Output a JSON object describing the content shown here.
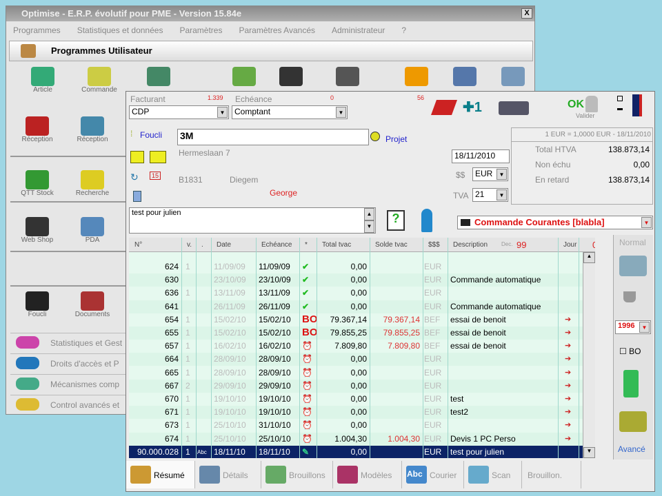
{
  "window": {
    "title": "Optimise  -  E.R.P. évolutif pour PME  -  Version 15.84e",
    "close": "X"
  },
  "menu": [
    "Programmes",
    "Statistiques et données",
    "Paramètres",
    "Paramètres Avancés",
    "Administrateur",
    "?"
  ],
  "programs_title": "Programmes Utilisateur",
  "launcher": [
    {
      "label": "Article",
      "color": "#3a7"
    },
    {
      "label": "Commande",
      "color": "#cc4"
    },
    {
      "label": "",
      "color": "#486"
    },
    {
      "label": "",
      "color": "#6a4"
    },
    {
      "label": "",
      "color": "#333"
    },
    {
      "label": "",
      "color": "#555"
    },
    {
      "label": "",
      "color": "#e90"
    },
    {
      "label": "",
      "color": "#57a"
    },
    {
      "label": "",
      "color": "#79b"
    }
  ],
  "side_icons": [
    {
      "label": "Réception",
      "color": "#b22"
    },
    {
      "label": "Réception",
      "color": "#48a"
    },
    {
      "label": "QTT Stock",
      "color": "#393"
    },
    {
      "label": "Recherche",
      "color": "#dc2"
    },
    {
      "label": "Web Shop",
      "color": "#333"
    },
    {
      "label": "PDA",
      "color": "#58b"
    },
    {
      "label": "Foucli",
      "color": "#222"
    },
    {
      "label": "Documents",
      "color": "#a33"
    }
  ],
  "side_items": [
    "Statistiques et Gest",
    "Droits d'accès et P",
    "Mécanismes comp",
    "Control avancés et"
  ],
  "doc": {
    "facturant_label": "Facturant",
    "facturant_count": "1.339",
    "echeance_label": "Echéance",
    "echeance_count": "0",
    "count3": "56",
    "facturant": "CDP",
    "echeance": "Comptant",
    "ok": "OK",
    "valider": "Valider",
    "foucli_link": "Foucli",
    "client": "3M",
    "projet_link": "Projet",
    "address": "Hermeslaan 7",
    "postcode": "B1831",
    "city": "Diegem",
    "contact": "George",
    "date": "18/11/2010",
    "currency_label": "$$",
    "currency": "EUR",
    "tva_label": "TVA",
    "tva": "21",
    "rate": "1 EUR = 1,0000 EUR - 18/11/2010",
    "totals": [
      {
        "label": "Total HTVA",
        "value": "138.873,14"
      },
      {
        "label": "Non échu",
        "value": "0,00"
      },
      {
        "label": "En retard",
        "value": "138.873,14"
      }
    ],
    "note": "test pour julien",
    "doc_type": "Commande Courantes [blabla]"
  },
  "columns": [
    "N°",
    "v.",
    ".",
    "Date",
    "Echéance",
    "*",
    "Total tvac",
    "Solde tvac",
    "$$$",
    "Description",
    "Jour"
  ],
  "dec_label": "Dec.",
  "dec_value": "99",
  "count_zero": "0",
  "rows": [
    {
      "n": "624",
      "v": "1",
      "date": "11/09/09",
      "ech": "11/09/09",
      "st": "check",
      "total": "0,00",
      "solde": "",
      "cur": "EUR",
      "desc": "",
      "jour": ""
    },
    {
      "n": "630",
      "v": "",
      "date": "23/10/09",
      "ech": "23/10/09",
      "st": "check",
      "total": "0,00",
      "solde": "",
      "cur": "EUR",
      "desc": "Commande automatique",
      "jour": ""
    },
    {
      "n": "636",
      "v": "1",
      "date": "13/11/09",
      "ech": "13/11/09",
      "st": "check",
      "total": "0,00",
      "solde": "",
      "cur": "EUR",
      "desc": "",
      "jour": ""
    },
    {
      "n": "641",
      "v": "",
      "date": "26/11/09",
      "ech": "26/11/09",
      "st": "check",
      "total": "0,00",
      "solde": "",
      "cur": "EUR",
      "desc": "Commande automatique",
      "jour": ""
    },
    {
      "n": "654",
      "v": "1",
      "date": "15/02/10",
      "ech": "15/02/10",
      "st": "BO",
      "total": "79.367,14",
      "solde": "79.367,14",
      "cur": "BEF",
      "desc": "essai de benoit",
      "jour": "arrow"
    },
    {
      "n": "655",
      "v": "1",
      "date": "15/02/10",
      "ech": "15/02/10",
      "st": "BO",
      "total": "79.855,25",
      "solde": "79.855,25",
      "cur": "BEF",
      "desc": "essai de benoit",
      "jour": "arrow"
    },
    {
      "n": "657",
      "v": "1",
      "date": "16/02/10",
      "ech": "16/02/10",
      "st": "clock",
      "total": "7.809,80",
      "solde": "7.809,80",
      "cur": "BEF",
      "desc": "essai de benoit",
      "jour": "arrow"
    },
    {
      "n": "664",
      "v": "1",
      "date": "28/09/10",
      "ech": "28/09/10",
      "st": "clock",
      "total": "0,00",
      "solde": "",
      "cur": "EUR",
      "desc": "",
      "jour": "arrow"
    },
    {
      "n": "665",
      "v": "1",
      "date": "28/09/10",
      "ech": "28/09/10",
      "st": "clock",
      "total": "0,00",
      "solde": "",
      "cur": "EUR",
      "desc": "",
      "jour": "arrow"
    },
    {
      "n": "667",
      "v": "2",
      "date": "29/09/10",
      "ech": "29/09/10",
      "st": "alarm",
      "total": "0,00",
      "solde": "",
      "cur": "EUR",
      "desc": "",
      "jour": "arrow"
    },
    {
      "n": "670",
      "v": "1",
      "date": "19/10/10",
      "ech": "19/10/10",
      "st": "clock",
      "total": "0,00",
      "solde": "",
      "cur": "EUR",
      "desc": "test",
      "jour": "arrow"
    },
    {
      "n": "671",
      "v": "1",
      "date": "19/10/10",
      "ech": "19/10/10",
      "st": "clock",
      "total": "0,00",
      "solde": "",
      "cur": "EUR",
      "desc": "test2",
      "jour": "arrow"
    },
    {
      "n": "673",
      "v": "1",
      "date": "25/10/10",
      "ech": "31/10/10",
      "st": "clock",
      "total": "0,00",
      "solde": "",
      "cur": "EUR",
      "desc": "",
      "jour": "arrow"
    },
    {
      "n": "674",
      "v": "1",
      "date": "25/10/10",
      "ech": "25/10/10",
      "st": "clock",
      "total": "1.004,30",
      "solde": "1.004,30",
      "cur": "EUR",
      "desc": "Devis 1 PC Perso",
      "jour": "arrow"
    },
    {
      "n": "90.000.028",
      "v": "1",
      "abc": "Abc",
      "date": "18/11/10",
      "ech": "18/11/10",
      "st": "edit",
      "total": "0,00",
      "solde": "",
      "cur": "EUR",
      "desc": "test pour julien",
      "jour": "",
      "selected": true
    }
  ],
  "right_panel": {
    "mode": "Normal",
    "year": "1996",
    "bo_label": "BO",
    "advanced": "Avancé"
  },
  "tabs": [
    "Résumé",
    "Détails",
    "Brouillons",
    "Modèles",
    "Courier",
    "Scan",
    "Brouillon."
  ],
  "tab_icon_text": "Abc"
}
